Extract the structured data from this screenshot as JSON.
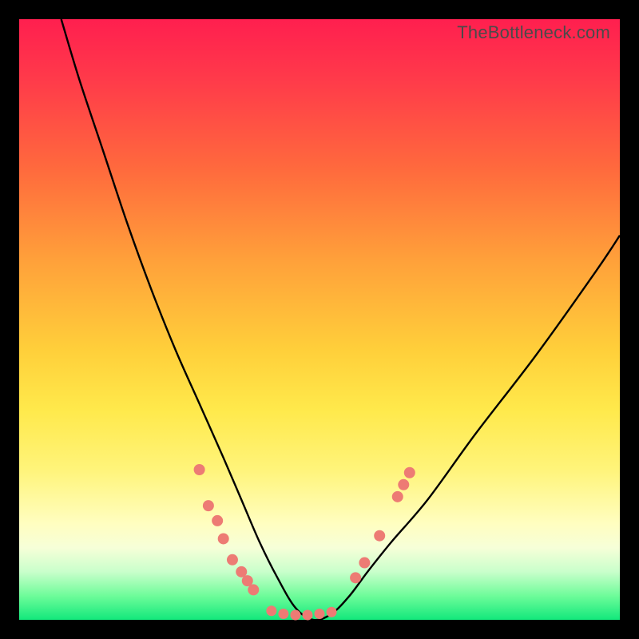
{
  "watermark": "TheBottleneck.com",
  "chart_data": {
    "type": "line",
    "title": "",
    "xlabel": "",
    "ylabel": "",
    "xlim": [
      0,
      100
    ],
    "ylim": [
      0,
      100
    ],
    "grid": false,
    "legend": false,
    "curve": {
      "description": "V-shaped bottleneck curve dipping to ~0 near x≈47",
      "x": [
        7,
        10,
        14,
        18,
        22,
        26,
        30,
        34,
        37,
        40,
        43,
        46,
        49,
        52,
        55,
        58,
        62,
        68,
        76,
        86,
        96,
        100
      ],
      "y": [
        100,
        90,
        78,
        66,
        55,
        45,
        36,
        27,
        20,
        13,
        7,
        2,
        0,
        1,
        4,
        8,
        13,
        20,
        31,
        44,
        58,
        64
      ]
    },
    "markers_left": {
      "description": "salmon dots on descending branch",
      "points": [
        {
          "x": 30.0,
          "y": 25.0
        },
        {
          "x": 31.5,
          "y": 19.0
        },
        {
          "x": 33.0,
          "y": 16.5
        },
        {
          "x": 34.0,
          "y": 13.5
        },
        {
          "x": 35.5,
          "y": 10.0
        },
        {
          "x": 37.0,
          "y": 8.0
        },
        {
          "x": 38.0,
          "y": 6.5
        },
        {
          "x": 39.0,
          "y": 5.0
        }
      ]
    },
    "markers_bottom": {
      "description": "salmon dots along trough",
      "points": [
        {
          "x": 42.0,
          "y": 1.5
        },
        {
          "x": 44.0,
          "y": 1.0
        },
        {
          "x": 46.0,
          "y": 0.8
        },
        {
          "x": 48.0,
          "y": 0.8
        },
        {
          "x": 50.0,
          "y": 1.0
        },
        {
          "x": 52.0,
          "y": 1.3
        }
      ]
    },
    "markers_right": {
      "description": "salmon dots on ascending branch",
      "points": [
        {
          "x": 56.0,
          "y": 7.0
        },
        {
          "x": 57.5,
          "y": 9.5
        },
        {
          "x": 60.0,
          "y": 14.0
        },
        {
          "x": 63.0,
          "y": 20.5
        },
        {
          "x": 64.0,
          "y": 22.5
        },
        {
          "x": 65.0,
          "y": 24.5
        }
      ]
    },
    "colors": {
      "curve": "#000000",
      "marker_fill": "#ed7b74",
      "marker_stroke": "#ed7b74"
    }
  }
}
